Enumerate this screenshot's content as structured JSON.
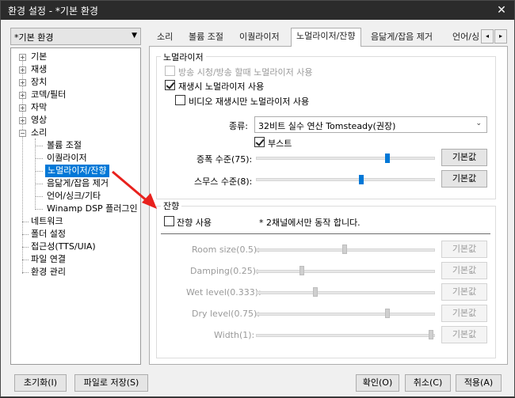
{
  "window": {
    "title": "환경 설정 - *기본 환경",
    "close_symbol": "✕"
  },
  "profile": {
    "selected": "*기본 환경"
  },
  "tree": {
    "items": [
      "기본",
      "재생",
      "장치",
      "코덱/필터",
      "자막",
      "영상",
      "소리",
      "볼륨 조절",
      "이퀄라이저",
      "노멀라이저/잔향",
      "음닮게/잡음 제거",
      "언어/싱크/기타",
      "Winamp DSP 플러그인",
      "네트워크",
      "폴더 설정",
      "접근성(TTS/UIA)",
      "파일 연결",
      "환경 관리"
    ],
    "expand_plus": "+",
    "expand_minus": "−"
  },
  "tabs": {
    "items": [
      "소리",
      "볼륨 조절",
      "이퀄라이저",
      "노멀라이저/잔향",
      "음닮게/잡음 제거",
      "언어/싱"
    ],
    "active": "노멀라이저/잔향",
    "prev": "◂",
    "next": "▸"
  },
  "normalizer": {
    "group_title": "노멀라이저",
    "broadcast_only": "방송 시청/방송 할때 노멀라이저 사용",
    "use_on_play": "재생시 노멀라이저 사용",
    "video_only": "비디오 재생시만 노멀라이저 사용",
    "type_label": "종류:",
    "type_value": "32비트 실수 연산 Tomsteady(권장)",
    "boost_label": "부스트",
    "amp_label": "증폭 수준(75):",
    "source_label": "스무스 수준(8):",
    "default_btn": "기본값",
    "checked": {
      "broadcast_only": false,
      "use_on_play": true,
      "video_only": false,
      "boost": true
    },
    "amp_level": 75,
    "source_level": 8
  },
  "reverb": {
    "group_title": "잔향",
    "use_label": "잔향 사용",
    "note": "* 2채널에서만 동작 합니다.",
    "checked": false,
    "rows": [
      {
        "label": "Room size(0.5):",
        "value": 0.5
      },
      {
        "label": "Damping(0.25):",
        "value": 0.25
      },
      {
        "label": "Wet level(0.333):",
        "value": 0.333
      },
      {
        "label": "Dry level(0.75):",
        "value": 0.75
      },
      {
        "label": "Width(1):",
        "value": 1
      }
    ],
    "default_btn": "기본값"
  },
  "footer": {
    "reset": "초기화(I)",
    "save_file": "파일로 저장(S)",
    "ok": "확인(O)",
    "cancel": "취소(C)",
    "apply": "적용(A)"
  },
  "colors": {
    "accent": "#0078d7",
    "annotation_arrow": "#e8211d",
    "titlebar": "#2b2b2b"
  }
}
